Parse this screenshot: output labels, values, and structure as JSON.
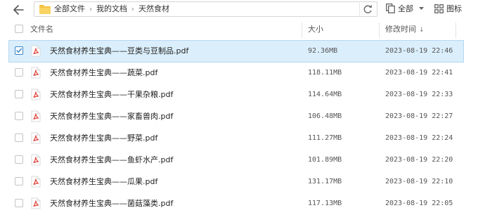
{
  "toolbar": {
    "back_icon": "back-arrow-icon",
    "breadcrumb": [
      "全部文件",
      "我的文档",
      "天然食材"
    ],
    "breadcrumb_separator": "›",
    "view_all_label": "全部",
    "grid_view_label": "图标"
  },
  "table": {
    "headers": {
      "name": "文件名",
      "size": "大小",
      "modified": "修改时间",
      "sort_indicator": "↓"
    },
    "rows": [
      {
        "name": "天然食材养生宝典——豆类与豆制品.pdf",
        "size": "92.36MB",
        "modified": "2023-08-19 22:46",
        "selected": true
      },
      {
        "name": "天然食材养生宝典——蔬菜.pdf",
        "size": "118.11MB",
        "modified": "2023-08-19 22:41",
        "selected": false
      },
      {
        "name": "天然食材养生宝典——干果杂粮.pdf",
        "size": "114.64MB",
        "modified": "2023-08-19 22:33",
        "selected": false
      },
      {
        "name": "天然食材养生宝典——家畜兽肉.pdf",
        "size": "106.48MB",
        "modified": "2023-08-19 22:27",
        "selected": false
      },
      {
        "name": "天然食材养生宝典——野菜.pdf",
        "size": "111.27MB",
        "modified": "2023-08-19 22:24",
        "selected": false
      },
      {
        "name": "天然食材养生宝典——鱼虾水产.pdf",
        "size": "101.89MB",
        "modified": "2023-08-19 22:20",
        "selected": false
      },
      {
        "name": "天然食材养生宝典——瓜果.pdf",
        "size": "131.17MB",
        "modified": "2023-08-19 22:10",
        "selected": false
      },
      {
        "name": "天然食材养生宝典——菌菇藻类.pdf",
        "size": "117.13MB",
        "modified": "2023-08-19 22:05",
        "selected": false
      }
    ]
  },
  "colors": {
    "selected_row_bg": "#dbeefb",
    "selected_row_border": "#b4d8f3",
    "folder_yellow": "#f6c342",
    "pdf_red": "#e0443e",
    "checkbox_blue": "#3a86c8"
  }
}
